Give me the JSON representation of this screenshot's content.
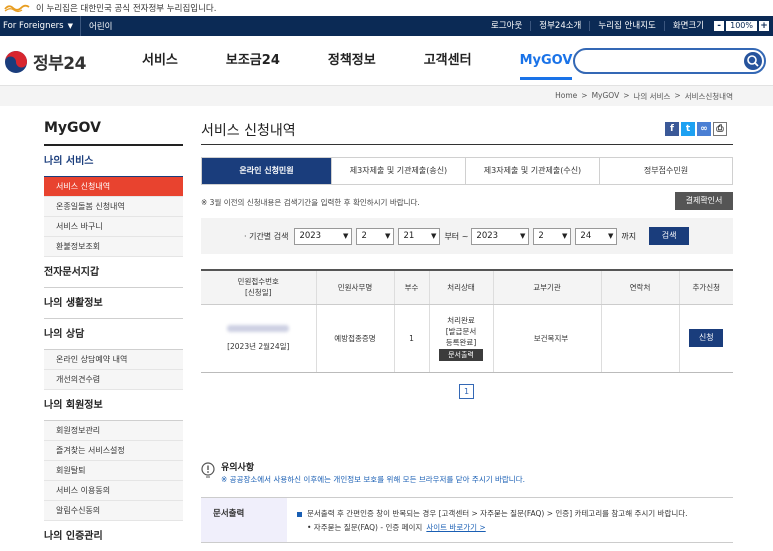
{
  "notice_bar": {
    "text": "이 누리집은 대한민국 공식 전자정부 누리집입니다."
  },
  "utility": {
    "lang": "For Foreigners",
    "kids": "어린이",
    "links": [
      "로그아웃",
      "정부24소개",
      "누리집 안내지도",
      "화면크기"
    ],
    "zoom_minus": "-",
    "zoom_value": "100%",
    "zoom_plus": "+"
  },
  "header": {
    "brand": "정부24",
    "nav": [
      "서비스",
      "보조금24",
      "정책정보",
      "고객센터",
      "MyGOV"
    ],
    "active_nav": "MyGOV",
    "search_placeholder": ""
  },
  "breadcrumb": [
    "Home",
    ">",
    "MyGOV",
    ">",
    "나의 서비스",
    ">",
    "서비스신청내역"
  ],
  "sidebar": {
    "title": "MyGOV",
    "sections": [
      {
        "label": "나의 서비스",
        "items": [
          "서비스 신청내역",
          "온종일돌봄 신청내역",
          "서비스 바구니",
          "환불정보조회"
        ]
      },
      {
        "label": "전자문서지갑",
        "items": []
      },
      {
        "label": "나의 생활정보",
        "items": []
      },
      {
        "label": "나의 상담",
        "items": [
          "온라인 상담예약 내역",
          "개선의견수렴"
        ]
      },
      {
        "label": "나의 회원정보",
        "items": [
          "회원정보관리",
          "즐겨찾는 서비스설정",
          "회원탈퇴",
          "서비스 이용동의",
          "알림수신동의"
        ]
      },
      {
        "label": "나의 인증관리",
        "items": []
      }
    ]
  },
  "content": {
    "title": "서비스 신청내역",
    "tabs": [
      "온라인 신청민원",
      "제3자제출 및 기관제출(송신)",
      "제3자제출 및 기관제출(수신)",
      "정부접수민원"
    ],
    "notice": "※ 3월 이전의 신청내용은 검색기간을 입력한 후 확인하시기 바랍니다.",
    "confirm_button": "결제확인서",
    "filter": {
      "label": "· 기간별 검색",
      "from": {
        "year": "2023",
        "month": "2",
        "day": "21"
      },
      "from_word": "부터 ~",
      "to": {
        "year": "2023",
        "month": "2",
        "day": "24"
      },
      "to_word": "까지",
      "search_button": "검색"
    },
    "table": {
      "headers": [
        "민원접수번호\n[신청일]",
        "민원사무명",
        "부수",
        "처리상태",
        "교부기관",
        "연락처",
        "추가신청"
      ],
      "row": {
        "date": "[2023년 2월24일]",
        "name": "예방접종증명",
        "copies": "1",
        "status": "처리완료\n[발급문서\n등록완료]",
        "print_button": "문서출력",
        "agency": "보건복지부",
        "contact": "",
        "apply_button": "신청"
      }
    },
    "page": "1",
    "caution": {
      "title": "유의사항",
      "text": "※ 공공장소에서 사용하신 이후에는 개인정보 보호를 위해 모든 브라우저를 닫아 주시기 바랍니다."
    },
    "info": {
      "label": "문서출력",
      "line1": "문서출력 후 간편인증 창이 반복되는 경우 [고객센터 > 자주묻는 질문(FAQ) > 인증] 카테고리를 참고해 주시기 바랍니다.",
      "line2": "• 자주묻는 질문(FAQ) - 인증 페이지",
      "link": "사이트 바로가기 >"
    }
  }
}
